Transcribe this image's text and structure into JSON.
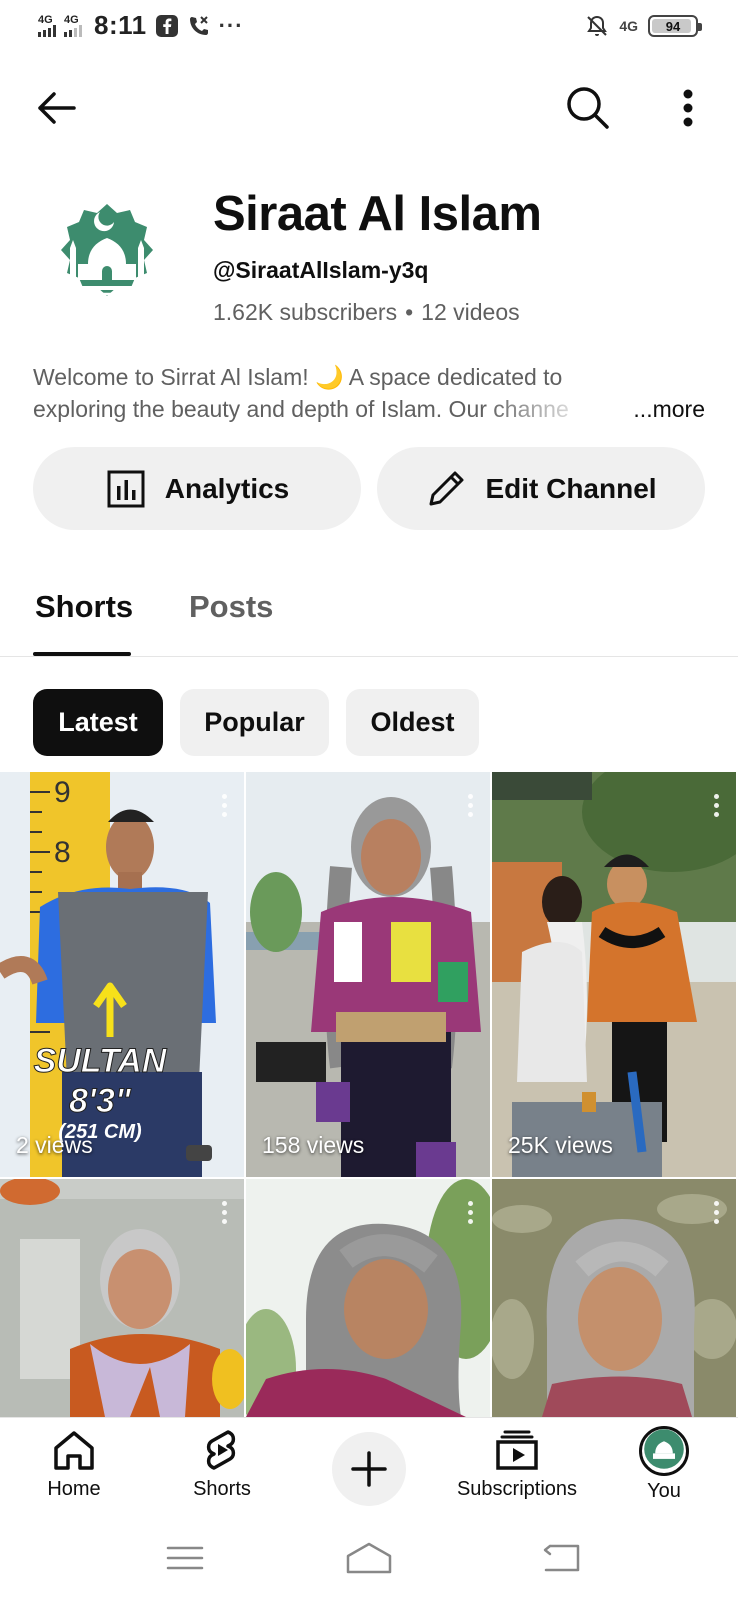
{
  "status_bar": {
    "net1": "4G",
    "net2": "4G",
    "time": "8:11",
    "more": "···",
    "net3": "4G",
    "battery": "94",
    "battery_level": 0.94
  },
  "channel": {
    "name": "Siraat Al Islam",
    "handle": "@SiraatAlIslam-y3q",
    "subscribers": "1.62K subscribers",
    "separator": "•",
    "videos": "12 videos",
    "description_line1": "Welcome to Sirrat Al Islam! 🌙 A space dedicated to",
    "description_line2": "exploring the beauty and depth of Islam. Our channe",
    "more_label": "...more",
    "brand_color": "#3d8c6e"
  },
  "actions": {
    "analytics_label": "Analytics",
    "edit_label": "Edit Channel"
  },
  "tabs": [
    {
      "label": "Shorts",
      "active": true
    },
    {
      "label": "Posts",
      "active": false
    }
  ],
  "chips": [
    {
      "label": "Latest",
      "selected": true
    },
    {
      "label": "Popular",
      "selected": false
    },
    {
      "label": "Oldest",
      "selected": false
    }
  ],
  "shorts": [
    {
      "views": "2 views",
      "overlay": [
        "SULTAN",
        "8'3\"",
        "(251 CM)"
      ],
      "ruler": [
        "9",
        "8"
      ]
    },
    {
      "views": "158 views"
    },
    {
      "views": "25K views"
    },
    {
      "views": ""
    },
    {
      "views": ""
    },
    {
      "views": ""
    }
  ],
  "bottom_nav": {
    "home": "Home",
    "shorts": "Shorts",
    "subscriptions": "Subscriptions",
    "you": "You"
  }
}
